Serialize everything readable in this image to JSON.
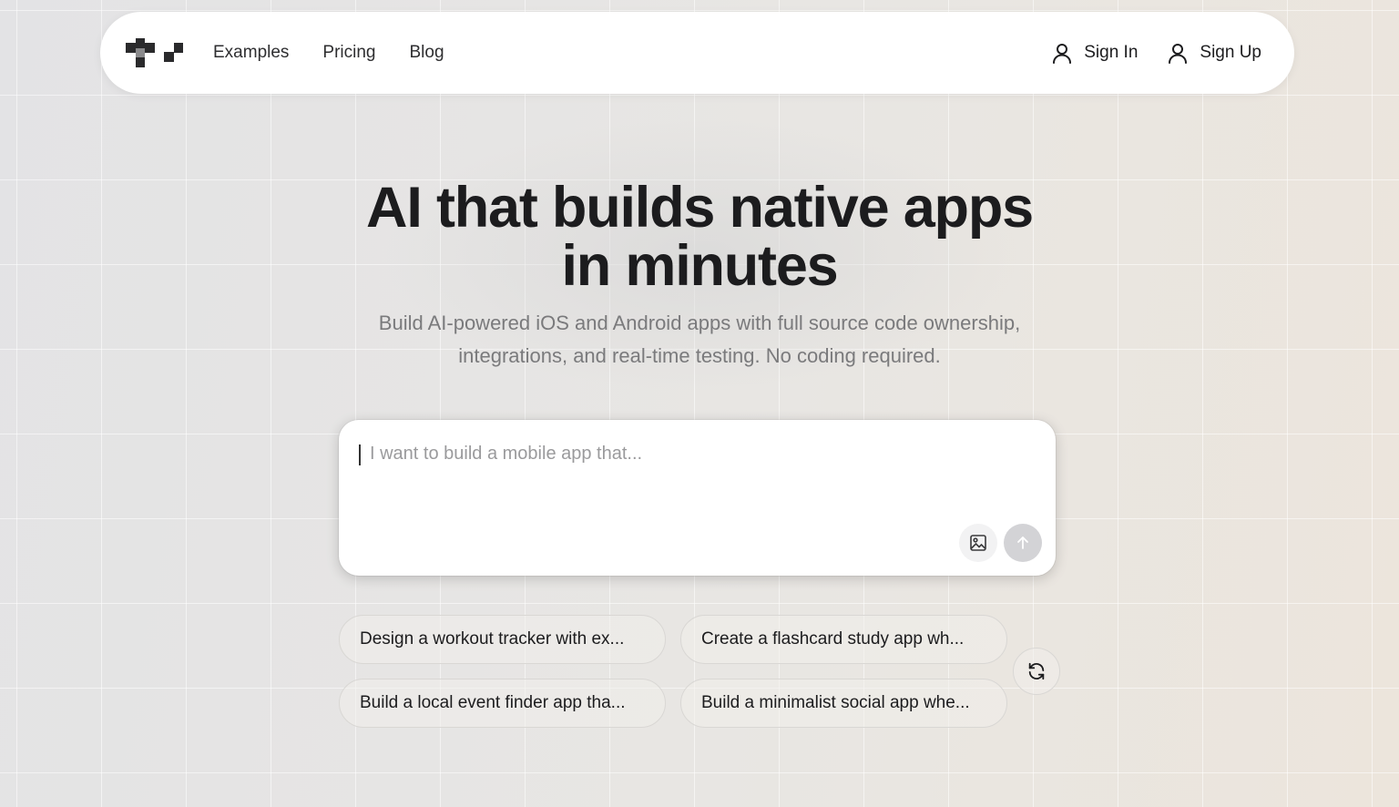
{
  "nav": {
    "links": [
      "Examples",
      "Pricing",
      "Blog"
    ],
    "sign_in": "Sign In",
    "sign_up": "Sign Up",
    "icons": {
      "logo": "pixel-logo-icon",
      "user": "user-icon"
    }
  },
  "hero": {
    "title_line1": "AI that builds native apps",
    "title_line2": "in minutes",
    "subtitle_line1": "Build AI-powered iOS and Android apps with full source code ownership,",
    "subtitle_line2": "integrations, and real-time testing. No coding required."
  },
  "prompt": {
    "placeholder": "I want to build a mobile app that...",
    "value": "",
    "icons": {
      "attach": "image-icon",
      "send": "arrow-up-icon"
    }
  },
  "suggestions": [
    "Design a workout tracker with ex...",
    "Create a flashcard study app wh...",
    "Build a local event finder app tha...",
    "Build a minimalist social app whe..."
  ],
  "refresh_icon": "refresh-icon",
  "colors": {
    "text": "#1c1c1e",
    "subtitle": "#7a7a7c",
    "send_disabled": "#d3d3d6"
  }
}
